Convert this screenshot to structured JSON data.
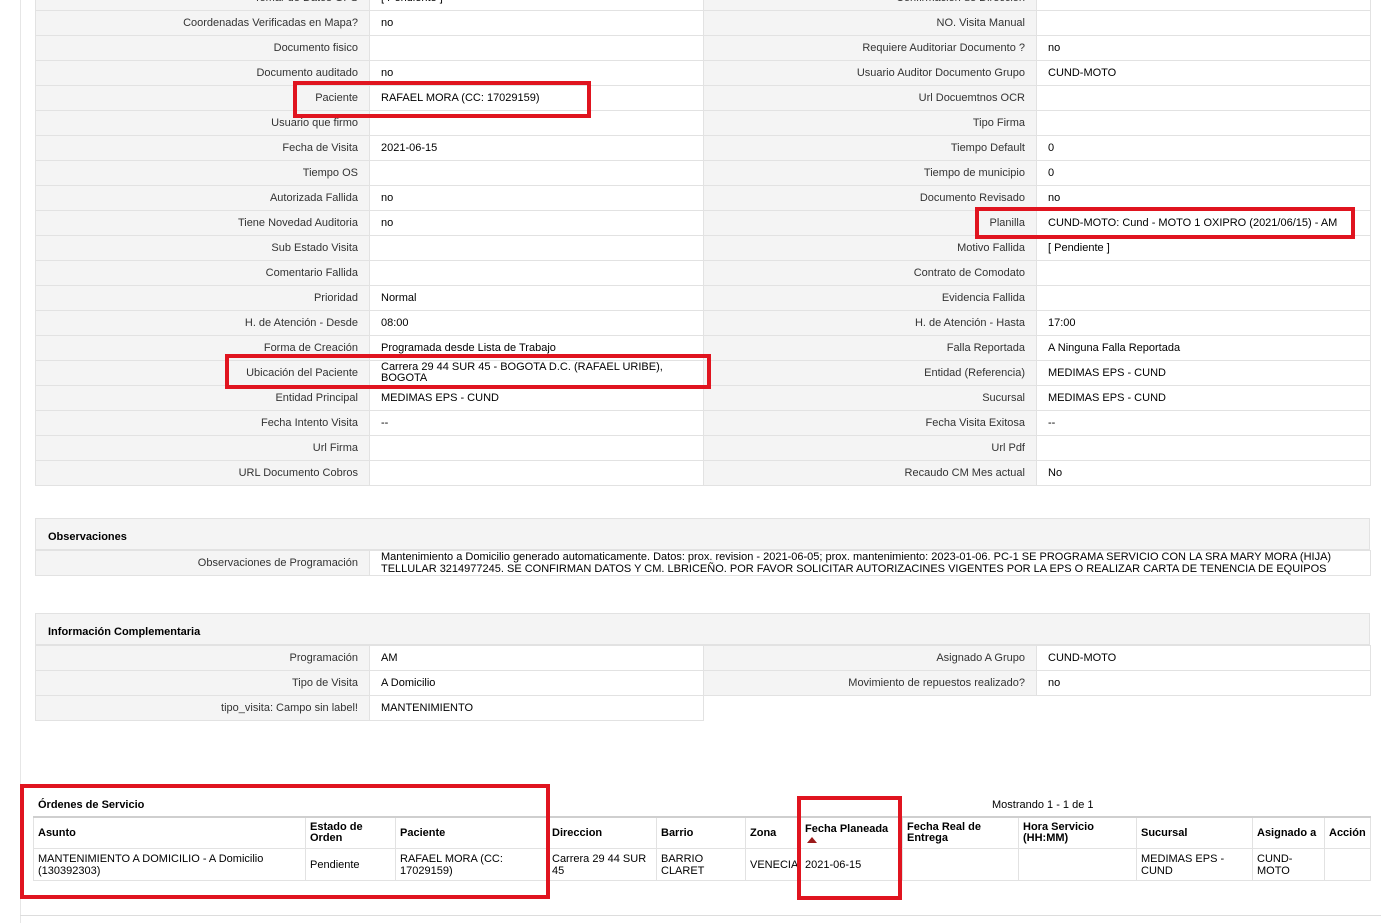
{
  "detail_rows": [
    {
      "l1": "Tomar de Datos GPS",
      "v1": "[ Pendiente ]",
      "l2": "Confirmación de Dirección",
      "v2": ""
    },
    {
      "l1": "Coordenadas Verificadas en Mapa?",
      "v1": "no",
      "l2": "NO. Visita Manual",
      "v2": ""
    },
    {
      "l1": "Documento fisico",
      "v1": "",
      "l2": "Requiere Auditoriar Documento ?",
      "v2": "no"
    },
    {
      "l1": "Documento auditado",
      "v1": "no",
      "l2": "Usuario Auditor Documento Grupo",
      "v2": "CUND-MOTO"
    },
    {
      "l1": "Paciente",
      "v1": "RAFAEL MORA (CC: 17029159)",
      "l2": "Url Docuemtnos OCR",
      "v2": ""
    },
    {
      "l1": "Usuario que firmo",
      "v1": "",
      "l2": "Tipo Firma",
      "v2": ""
    },
    {
      "l1": "Fecha de Visita",
      "v1": "2021-06-15",
      "l2": "Tiempo Default",
      "v2": "0"
    },
    {
      "l1": "Tiempo OS",
      "v1": "",
      "l2": "Tiempo de municipio",
      "v2": "0"
    },
    {
      "l1": "Autorizada Fallida",
      "v1": "no",
      "l2": "Documento Revisado",
      "v2": "no"
    },
    {
      "l1": "Tiene Novedad Auditoria",
      "v1": "no",
      "l2": "Planilla",
      "v2": "CUND-MOTO: Cund - MOTO 1 OXIPRO (2021/06/15) - AM"
    },
    {
      "l1": "Sub Estado Visita",
      "v1": "",
      "l2": "Motivo Fallida",
      "v2": "[ Pendiente ]"
    },
    {
      "l1": "Comentario Fallida",
      "v1": "",
      "l2": "Contrato de Comodato",
      "v2": ""
    },
    {
      "l1": "Prioridad",
      "v1": "Normal",
      "l2": "Evidencia Fallida",
      "v2": ""
    },
    {
      "l1": "H. de Atención - Desde",
      "v1": "08:00",
      "l2": "H. de Atención - Hasta",
      "v2": "17:00"
    },
    {
      "l1": "Forma de Creación",
      "v1": "Programada desde Lista de Trabajo",
      "l2": "Falla Reportada",
      "v2": "A Ninguna Falla Reportada"
    },
    {
      "l1": "Ubicación del Paciente",
      "v1": "Carrera 29 44 SUR 45 - BOGOTA D.C. (RAFAEL URIBE), BOGOTA",
      "l2": "Entidad (Referencia)",
      "v2": "MEDIMAS EPS - CUND"
    },
    {
      "l1": "Entidad Principal",
      "v1": "MEDIMAS EPS - CUND",
      "l2": "Sucursal",
      "v2": "MEDIMAS EPS - CUND"
    },
    {
      "l1": "Fecha Intento Visita",
      "v1": "--",
      "l2": "Fecha Visita Exitosa",
      "v2": "--"
    },
    {
      "l1": "Url Firma",
      "v1": "",
      "l2": "Url Pdf",
      "v2": ""
    },
    {
      "l1": "URL Documento Cobros",
      "v1": "",
      "l2": "Recaudo CM Mes actual",
      "v2": "No"
    }
  ],
  "observaciones": {
    "title": "Observaciones",
    "label": "Observaciones de Programación",
    "value": "Mantenimiento a Domicilio generado automaticamente. Datos: prox. revision - 2021-06-05; prox. mantenimiento: 2023-01-06. PC-1 SE PROGRAMA SERVICIO CON LA SRA MARY MORA (HIJA) TELLULAR 3214977245. SE CONFIRMAN DATOS Y CM. LBRICEÑO. POR FAVOR SOLICITAR AUTORIZACINES VIGENTES POR LA EPS O REALIZAR CARTA DE TENENCIA DE EQUIPOS"
  },
  "complementaria": {
    "title": "Información Complementaria",
    "rows": [
      {
        "l1": "Programación",
        "v1": "AM",
        "l2": "Asignado A Grupo",
        "v2": "CUND-MOTO"
      },
      {
        "l1": "Tipo de Visita",
        "v1": "A Domicilio",
        "l2": "Movimiento de repuestos realizado?",
        "v2": "no"
      },
      {
        "l1": "tipo_visita: Campo sin label!",
        "v1": "MANTENIMIENTO"
      }
    ]
  },
  "ordenes": {
    "title": "Órdenes de Servicio",
    "count_text": "Mostrando 1 - 1 de 1",
    "columns": [
      "Asunto",
      "Estado de Orden",
      "Paciente",
      "Direccion",
      "Barrio",
      "Zona",
      "Fecha Planeada",
      "Fecha Real de Entrega",
      "Hora Servicio (HH:MM)",
      "Sucursal",
      "Asignado a",
      "Acción"
    ],
    "sort_icon": "sort-asc-icon",
    "rows": [
      {
        "asunto": "MANTENIMIENTO A DOMICILIO - A Domicilio (130392303)",
        "estado": "Pendiente",
        "paciente": "RAFAEL MORA (CC: 17029159)",
        "direccion": "Carrera 29 44 SUR 45",
        "barrio": "BARRIO CLARET",
        "zona": "VENECIA",
        "fecha_planeada": "2021-06-15",
        "fecha_real": "",
        "hora": "",
        "sucursal": "MEDIMAS EPS - CUND",
        "asignado": "CUND-MOTO",
        "accion": ""
      }
    ]
  },
  "highlight_color": "#e0141f"
}
